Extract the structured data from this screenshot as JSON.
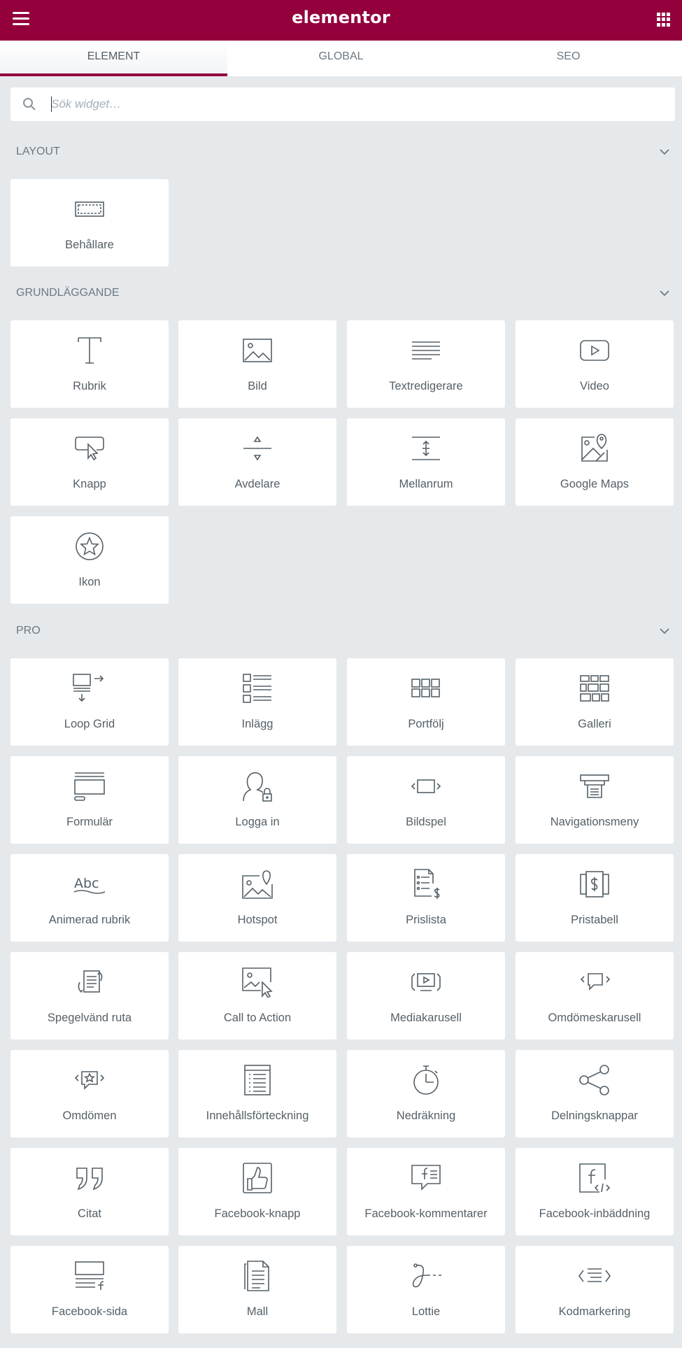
{
  "header": {
    "brand": "elementor",
    "menu_icon": "hamburger-icon",
    "apps_icon": "grid-icon",
    "color": "#93003c"
  },
  "tabs": [
    {
      "label": "ELEMENT",
      "active": true
    },
    {
      "label": "GLOBAL",
      "active": false
    },
    {
      "label": "SEO",
      "active": false
    }
  ],
  "search": {
    "placeholder": "Sök widget…",
    "value": ""
  },
  "categories": [
    {
      "title": "LAYOUT",
      "widgets": [
        {
          "label": "Behållare",
          "icon": "container-icon"
        }
      ]
    },
    {
      "title": "GRUNDLÄGGANDE",
      "widgets": [
        {
          "label": "Rubrik",
          "icon": "heading-icon"
        },
        {
          "label": "Bild",
          "icon": "image-icon"
        },
        {
          "label": "Textredigerare",
          "icon": "text-editor-icon"
        },
        {
          "label": "Video",
          "icon": "video-icon"
        },
        {
          "label": "Knapp",
          "icon": "button-icon"
        },
        {
          "label": "Avdelare",
          "icon": "divider-icon"
        },
        {
          "label": "Mellanrum",
          "icon": "spacer-icon"
        },
        {
          "label": "Google Maps",
          "icon": "google-maps-icon"
        },
        {
          "label": "Ikon",
          "icon": "star-icon"
        }
      ]
    },
    {
      "title": "PRO",
      "widgets": [
        {
          "label": "Loop Grid",
          "icon": "loop-grid-icon"
        },
        {
          "label": "Inlägg",
          "icon": "posts-icon"
        },
        {
          "label": "Portfölj",
          "icon": "portfolio-icon"
        },
        {
          "label": "Galleri",
          "icon": "gallery-icon"
        },
        {
          "label": "Formulär",
          "icon": "form-icon"
        },
        {
          "label": "Logga in",
          "icon": "login-icon"
        },
        {
          "label": "Bildspel",
          "icon": "slides-icon"
        },
        {
          "label": "Navigationsmeny",
          "icon": "nav-menu-icon"
        },
        {
          "label": "Animerad rubrik",
          "icon": "animated-headline-icon"
        },
        {
          "label": "Hotspot",
          "icon": "hotspot-icon"
        },
        {
          "label": "Prislista",
          "icon": "price-list-icon"
        },
        {
          "label": "Pristabell",
          "icon": "price-table-icon"
        },
        {
          "label": "Spegelvänd ruta",
          "icon": "flip-box-icon"
        },
        {
          "label": "Call to Action",
          "icon": "call-to-action-icon"
        },
        {
          "label": "Mediakarusell",
          "icon": "media-carousel-icon"
        },
        {
          "label": "Omdömeskarusell",
          "icon": "testimonial-carousel-icon"
        },
        {
          "label": "Omdömen",
          "icon": "reviews-icon"
        },
        {
          "label": "Innehållsförteckning",
          "icon": "table-of-contents-icon"
        },
        {
          "label": "Nedräkning",
          "icon": "countdown-icon"
        },
        {
          "label": "Delningsknappar",
          "icon": "share-icon"
        },
        {
          "label": "Citat",
          "icon": "quote-icon"
        },
        {
          "label": "Facebook-knapp",
          "icon": "facebook-like-icon"
        },
        {
          "label": "Facebook-kommentarer",
          "icon": "facebook-comments-icon"
        },
        {
          "label": "Facebook-inbäddning",
          "icon": "facebook-embed-icon"
        },
        {
          "label": "Facebook-sida",
          "icon": "facebook-page-icon"
        },
        {
          "label": "Mall",
          "icon": "template-icon"
        },
        {
          "label": "Lottie",
          "icon": "lottie-icon"
        },
        {
          "label": "Kodmarkering",
          "icon": "code-highlight-icon"
        }
      ]
    }
  ]
}
